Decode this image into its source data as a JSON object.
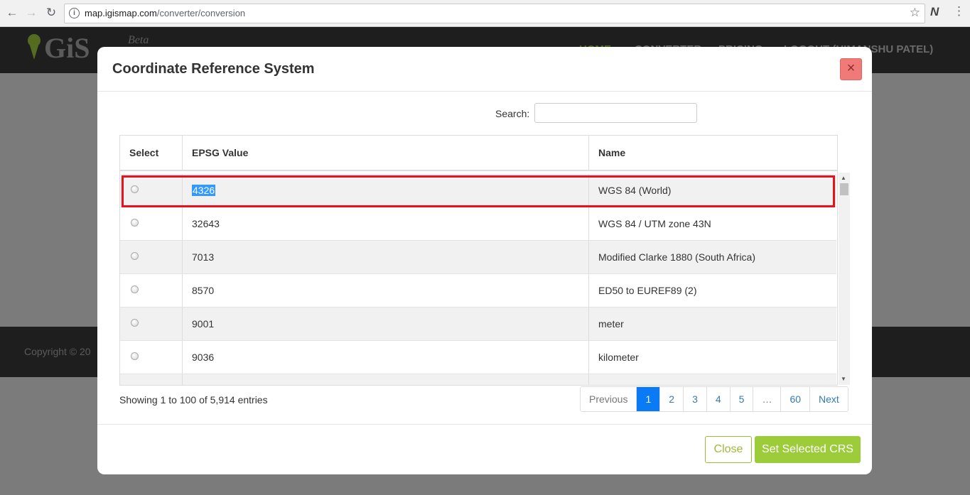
{
  "browser": {
    "url_host": "map.igismap.com",
    "url_path": "/converter/conversion",
    "back_glyph": "←",
    "forward_glyph": "→",
    "reload_glyph": "↻",
    "star_glyph": "☆",
    "menu_glyph": "⋮",
    "info_glyph": "i",
    "extension_glyph": "N"
  },
  "site": {
    "logo_text": "GiS",
    "beta_label": "Beta",
    "nav": [
      "HOME",
      "CONVERTER",
      "PRICING",
      "LOGOUT (HIMANSHU PATEL)"
    ],
    "footer_text": "Copyright © 20"
  },
  "modal": {
    "title": "Coordinate Reference System",
    "close_glyph": "×",
    "search_label": "Search:",
    "search_value": "",
    "columns": [
      "Select",
      "EPSG Value",
      "Name"
    ],
    "rows": [
      {
        "epsg": "4326",
        "name": "WGS 84 (World)",
        "selected_text": true
      },
      {
        "epsg": "32643",
        "name": "WGS 84 / UTM zone 43N"
      },
      {
        "epsg": "7013",
        "name": "Modified Clarke 1880 (South Africa)"
      },
      {
        "epsg": "8570",
        "name": "ED50 to EUREF89 (2)"
      },
      {
        "epsg": "9001",
        "name": "meter"
      },
      {
        "epsg": "9036",
        "name": "kilometer"
      }
    ],
    "info": "Showing 1 to 100 of 5,914 entries",
    "pagination": [
      "Previous",
      "1",
      "2",
      "3",
      "4",
      "5",
      "…",
      "60",
      "Next"
    ],
    "active_page": "1",
    "close_button": "Close",
    "set_button": "Set Selected CRS"
  },
  "colors": {
    "highlight": "#e8121f",
    "accent_green": "#9dcc3a",
    "active_page": "#0a7bf5"
  }
}
